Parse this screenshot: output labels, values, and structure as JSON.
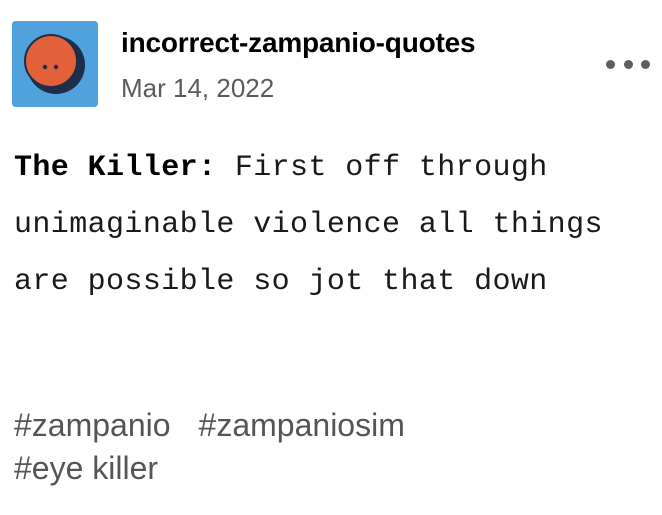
{
  "post": {
    "blog_name": "incorrect-zampanio-quotes",
    "date": "Mar 14, 2022",
    "avatar_icon": "orange-face-avatar-icon",
    "more_icon": "more-options-icon",
    "quote": {
      "speaker": "The Killer:",
      "text": "First off through unimaginable violence all things are possible so jot that down"
    },
    "tags": [
      "#zampanio",
      "#zampaniosim",
      "#eye killer"
    ]
  },
  "colors": {
    "avatar_background": "#4fa2dc",
    "avatar_face": "#e2603a",
    "avatar_outline": "#1e2e4a",
    "date_text": "#5b5b5b",
    "tag_text": "#555555"
  }
}
